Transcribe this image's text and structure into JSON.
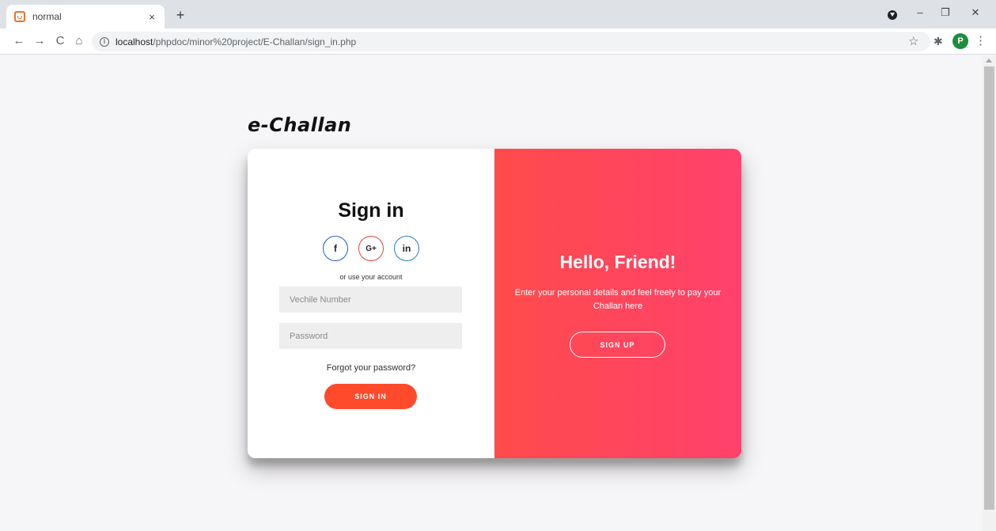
{
  "browser": {
    "tab_title": "normal",
    "tab_close": "×",
    "new_tab": "+",
    "url_host": "localhost",
    "url_path": "/phpdoc/minor%20project/E-Challan/sign_in.php",
    "profile_initial": "P",
    "icons": {
      "back": "←",
      "forward": "→",
      "reload": "C",
      "home": "⌂",
      "info": "i",
      "star": "☆",
      "extensions": "✱",
      "menu": "⋮",
      "minimize": "–",
      "maximize": "❐",
      "close": "✕"
    }
  },
  "page": {
    "brand": "e-Challan"
  },
  "signin": {
    "title": "Sign in",
    "social": {
      "facebook": "f",
      "google": "G+",
      "linkedin": "in"
    },
    "or_text": "or use your account",
    "vehicle_placeholder": "Vechile Number",
    "password_placeholder": "Password",
    "forgot": "Forgot your password?",
    "button": "SIGN IN"
  },
  "overlay": {
    "title": "Hello, Friend!",
    "text": "Enter your personal details and feel freely to pay your Challan here",
    "button": "SIGN UP"
  },
  "colors": {
    "accent": "#ff4b2b",
    "gradient_start": "#ff4b4b",
    "gradient_end": "#ff416c",
    "background": "#f6f5f7"
  }
}
